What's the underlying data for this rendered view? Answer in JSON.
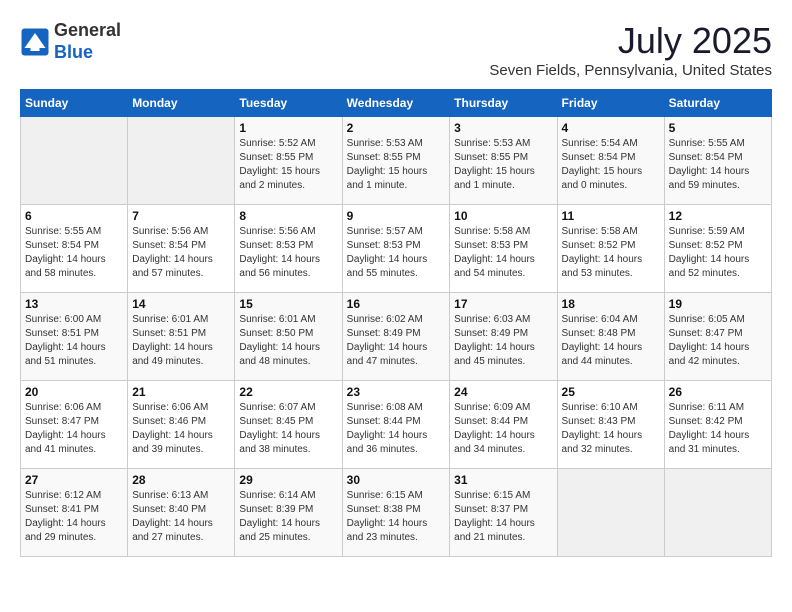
{
  "header": {
    "logo_line1": "General",
    "logo_line2": "Blue",
    "month_year": "July 2025",
    "location": "Seven Fields, Pennsylvania, United States"
  },
  "days_of_week": [
    "Sunday",
    "Monday",
    "Tuesday",
    "Wednesday",
    "Thursday",
    "Friday",
    "Saturday"
  ],
  "weeks": [
    [
      {
        "day": "",
        "sunrise": "",
        "sunset": "",
        "daylight": ""
      },
      {
        "day": "",
        "sunrise": "",
        "sunset": "",
        "daylight": ""
      },
      {
        "day": "1",
        "sunrise": "Sunrise: 5:52 AM",
        "sunset": "Sunset: 8:55 PM",
        "daylight": "Daylight: 15 hours and 2 minutes."
      },
      {
        "day": "2",
        "sunrise": "Sunrise: 5:53 AM",
        "sunset": "Sunset: 8:55 PM",
        "daylight": "Daylight: 15 hours and 1 minute."
      },
      {
        "day": "3",
        "sunrise": "Sunrise: 5:53 AM",
        "sunset": "Sunset: 8:55 PM",
        "daylight": "Daylight: 15 hours and 1 minute."
      },
      {
        "day": "4",
        "sunrise": "Sunrise: 5:54 AM",
        "sunset": "Sunset: 8:54 PM",
        "daylight": "Daylight: 15 hours and 0 minutes."
      },
      {
        "day": "5",
        "sunrise": "Sunrise: 5:55 AM",
        "sunset": "Sunset: 8:54 PM",
        "daylight": "Daylight: 14 hours and 59 minutes."
      }
    ],
    [
      {
        "day": "6",
        "sunrise": "Sunrise: 5:55 AM",
        "sunset": "Sunset: 8:54 PM",
        "daylight": "Daylight: 14 hours and 58 minutes."
      },
      {
        "day": "7",
        "sunrise": "Sunrise: 5:56 AM",
        "sunset": "Sunset: 8:54 PM",
        "daylight": "Daylight: 14 hours and 57 minutes."
      },
      {
        "day": "8",
        "sunrise": "Sunrise: 5:56 AM",
        "sunset": "Sunset: 8:53 PM",
        "daylight": "Daylight: 14 hours and 56 minutes."
      },
      {
        "day": "9",
        "sunrise": "Sunrise: 5:57 AM",
        "sunset": "Sunset: 8:53 PM",
        "daylight": "Daylight: 14 hours and 55 minutes."
      },
      {
        "day": "10",
        "sunrise": "Sunrise: 5:58 AM",
        "sunset": "Sunset: 8:53 PM",
        "daylight": "Daylight: 14 hours and 54 minutes."
      },
      {
        "day": "11",
        "sunrise": "Sunrise: 5:58 AM",
        "sunset": "Sunset: 8:52 PM",
        "daylight": "Daylight: 14 hours and 53 minutes."
      },
      {
        "day": "12",
        "sunrise": "Sunrise: 5:59 AM",
        "sunset": "Sunset: 8:52 PM",
        "daylight": "Daylight: 14 hours and 52 minutes."
      }
    ],
    [
      {
        "day": "13",
        "sunrise": "Sunrise: 6:00 AM",
        "sunset": "Sunset: 8:51 PM",
        "daylight": "Daylight: 14 hours and 51 minutes."
      },
      {
        "day": "14",
        "sunrise": "Sunrise: 6:01 AM",
        "sunset": "Sunset: 8:51 PM",
        "daylight": "Daylight: 14 hours and 49 minutes."
      },
      {
        "day": "15",
        "sunrise": "Sunrise: 6:01 AM",
        "sunset": "Sunset: 8:50 PM",
        "daylight": "Daylight: 14 hours and 48 minutes."
      },
      {
        "day": "16",
        "sunrise": "Sunrise: 6:02 AM",
        "sunset": "Sunset: 8:49 PM",
        "daylight": "Daylight: 14 hours and 47 minutes."
      },
      {
        "day": "17",
        "sunrise": "Sunrise: 6:03 AM",
        "sunset": "Sunset: 8:49 PM",
        "daylight": "Daylight: 14 hours and 45 minutes."
      },
      {
        "day": "18",
        "sunrise": "Sunrise: 6:04 AM",
        "sunset": "Sunset: 8:48 PM",
        "daylight": "Daylight: 14 hours and 44 minutes."
      },
      {
        "day": "19",
        "sunrise": "Sunrise: 6:05 AM",
        "sunset": "Sunset: 8:47 PM",
        "daylight": "Daylight: 14 hours and 42 minutes."
      }
    ],
    [
      {
        "day": "20",
        "sunrise": "Sunrise: 6:06 AM",
        "sunset": "Sunset: 8:47 PM",
        "daylight": "Daylight: 14 hours and 41 minutes."
      },
      {
        "day": "21",
        "sunrise": "Sunrise: 6:06 AM",
        "sunset": "Sunset: 8:46 PM",
        "daylight": "Daylight: 14 hours and 39 minutes."
      },
      {
        "day": "22",
        "sunrise": "Sunrise: 6:07 AM",
        "sunset": "Sunset: 8:45 PM",
        "daylight": "Daylight: 14 hours and 38 minutes."
      },
      {
        "day": "23",
        "sunrise": "Sunrise: 6:08 AM",
        "sunset": "Sunset: 8:44 PM",
        "daylight": "Daylight: 14 hours and 36 minutes."
      },
      {
        "day": "24",
        "sunrise": "Sunrise: 6:09 AM",
        "sunset": "Sunset: 8:44 PM",
        "daylight": "Daylight: 14 hours and 34 minutes."
      },
      {
        "day": "25",
        "sunrise": "Sunrise: 6:10 AM",
        "sunset": "Sunset: 8:43 PM",
        "daylight": "Daylight: 14 hours and 32 minutes."
      },
      {
        "day": "26",
        "sunrise": "Sunrise: 6:11 AM",
        "sunset": "Sunset: 8:42 PM",
        "daylight": "Daylight: 14 hours and 31 minutes."
      }
    ],
    [
      {
        "day": "27",
        "sunrise": "Sunrise: 6:12 AM",
        "sunset": "Sunset: 8:41 PM",
        "daylight": "Daylight: 14 hours and 29 minutes."
      },
      {
        "day": "28",
        "sunrise": "Sunrise: 6:13 AM",
        "sunset": "Sunset: 8:40 PM",
        "daylight": "Daylight: 14 hours and 27 minutes."
      },
      {
        "day": "29",
        "sunrise": "Sunrise: 6:14 AM",
        "sunset": "Sunset: 8:39 PM",
        "daylight": "Daylight: 14 hours and 25 minutes."
      },
      {
        "day": "30",
        "sunrise": "Sunrise: 6:15 AM",
        "sunset": "Sunset: 8:38 PM",
        "daylight": "Daylight: 14 hours and 23 minutes."
      },
      {
        "day": "31",
        "sunrise": "Sunrise: 6:15 AM",
        "sunset": "Sunset: 8:37 PM",
        "daylight": "Daylight: 14 hours and 21 minutes."
      },
      {
        "day": "",
        "sunrise": "",
        "sunset": "",
        "daylight": ""
      },
      {
        "day": "",
        "sunrise": "",
        "sunset": "",
        "daylight": ""
      }
    ]
  ]
}
